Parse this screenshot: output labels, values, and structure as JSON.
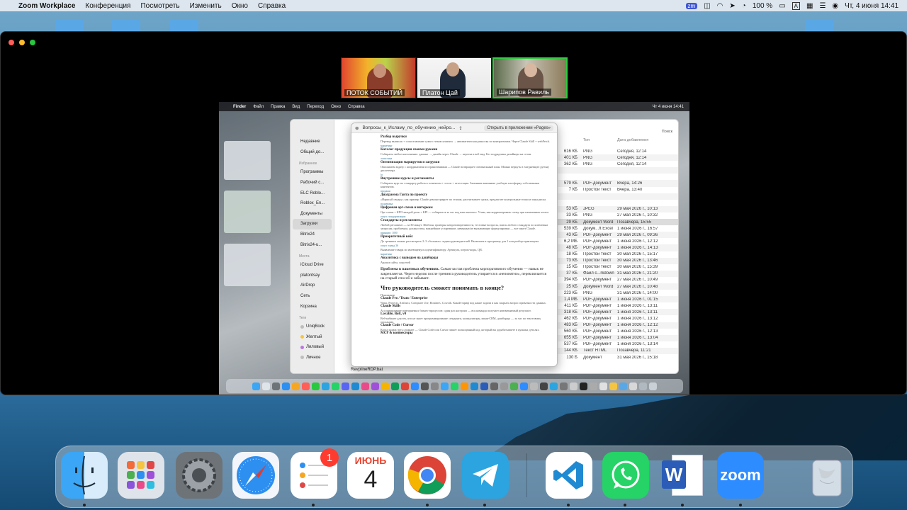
{
  "menubar": {
    "app_name": "Zoom Workplace",
    "menus": [
      "Конференция",
      "Посмотреть",
      "Изменить",
      "Окно",
      "Справка"
    ],
    "battery": "100 %",
    "input_badge": "A",
    "datetime": "Чт, 4 июня  14:41"
  },
  "participants": [
    {
      "name": "ПОТОК СОБЫТИЙ"
    },
    {
      "name": "Платон Цай"
    },
    {
      "name": "Шарипов Равиль"
    }
  ],
  "shared_screen": {
    "menubar": {
      "app": "Finder",
      "menus": [
        "Файл",
        "Правка",
        "Вид",
        "Переход",
        "Окно",
        "Справка"
      ],
      "datetime": "Чт 4 июня  14:41"
    },
    "finder": {
      "sidebar": {
        "recent": [
          "Недавние",
          "Общий до..."
        ],
        "favorites_title": "Избранное",
        "favorites": [
          "Программы",
          "Рабочий с...",
          "ELC Roblo...",
          "Roblox_En...",
          "Документы",
          "Загрузки",
          "Bitrix24",
          "Bitrix24-u..."
        ],
        "places_title": "Места",
        "places": [
          "iCloud Drive",
          "platontsay",
          "AirDrop",
          "Сеть",
          "Корзина"
        ],
        "tags_title": "Теги",
        "tags": [
          {
            "label": "UniqBook",
            "color": "#bdbdbd"
          },
          {
            "label": "Желтый",
            "color": "#f5c542"
          },
          {
            "label": "Лиловый",
            "color": "#b87ad9"
          },
          {
            "label": "Личное",
            "color": "#bdbdbd"
          }
        ]
      },
      "columns": {
        "type": "Тип",
        "date": "Дата добавления",
        "search": "Поиск"
      },
      "rows": [
        {
          "size": "616 КБ",
          "type": "PNG",
          "date": "Сегодня, 12:14"
        },
        {
          "size": "401 КБ",
          "type": "PNG",
          "date": "Сегодня, 12:14"
        },
        {
          "size": "362 КБ",
          "type": "PNG",
          "date": "Сегодня, 12:14"
        },
        {
          "size": "",
          "type": "",
          "date": ""
        },
        {
          "size": "",
          "type": "",
          "date": ""
        },
        {
          "size": "579 КБ",
          "type": "PDF-документ",
          "date": "Вчера, 14:26"
        },
        {
          "size": "7 КБ",
          "type": "Простой текст",
          "date": "Вчера, 13:40"
        },
        {
          "size": "",
          "type": "",
          "date": ""
        },
        {
          "size": "",
          "type": "",
          "date": ""
        },
        {
          "size": "53 КБ",
          "type": "JPEG",
          "date": "29 мая 2026 г., 10:13"
        },
        {
          "size": "33 КБ",
          "type": "PNG",
          "date": "27 мая 2026 г., 10:32"
        },
        {
          "size": "29 КБ",
          "type": "Документ Word",
          "date": "Позавчера, 15:55"
        },
        {
          "size": "539 КБ",
          "type": "Докум...ft Excel",
          "date": "1 июня 2026 г., 16:57"
        },
        {
          "size": "43 КБ",
          "type": "PDF-документ",
          "date": "29 мая 2026 г., 09:36"
        },
        {
          "size": "6,2 МБ",
          "type": "PDF-документ",
          "date": "1 июня 2026 г., 12:12"
        },
        {
          "size": "48 КБ",
          "type": "PDF-документ",
          "date": "1 июня 2026 г., 14:13"
        },
        {
          "size": "18 КБ",
          "type": "Простой текст",
          "date": "30 мая 2026 г., 15:17"
        },
        {
          "size": "73 КБ",
          "type": "Простой текст",
          "date": "30 мая 2026 г., 13:46"
        },
        {
          "size": "15 КБ",
          "type": "Простой текст",
          "date": "30 мая 2026 г., 15:39"
        },
        {
          "size": "37 КБ",
          "type": "Файл с...rkdown",
          "date": "31 мая 2026 г., 21:20"
        },
        {
          "size": "394 КБ",
          "type": "PDF-документ",
          "date": "27 мая 2026 г., 10:49"
        },
        {
          "size": "25 КБ",
          "type": "Документ Word",
          "date": "27 мая 2026 г., 10:48"
        },
        {
          "size": "223 КБ",
          "type": "PNG",
          "date": "31 мая 2026 г., 14:00"
        },
        {
          "size": "1,4 МБ",
          "type": "PDF-документ",
          "date": "1 июня 2026 г., 01:15"
        },
        {
          "size": "411 КБ",
          "type": "PDF-документ",
          "date": "1 июня 2026 г., 13:11"
        },
        {
          "size": "318 КБ",
          "type": "PDF-документ",
          "date": "1 июня 2026 г., 13:11"
        },
        {
          "size": "462 КБ",
          "type": "PDF-документ",
          "date": "1 июня 2026 г., 13:12"
        },
        {
          "size": "483 КБ",
          "type": "PDF-документ",
          "date": "1 июня 2026 г., 12:12"
        },
        {
          "size": "560 КБ",
          "type": "PDF-документ",
          "date": "1 июня 2026 г., 12:13"
        },
        {
          "size": "655 КБ",
          "type": "PDF-документ",
          "date": "1 июня 2026 г., 13:04"
        },
        {
          "size": "537 КБ",
          "type": "PDF-документ",
          "date": "1 июня 2026 г., 13:14"
        },
        {
          "size": "144 КБ",
          "type": "Текст HTML",
          "date": "Позавчера, 11:21"
        },
        {
          "size": "130 Б",
          "type": "Документ",
          "date": "31 мая 2026 г., 15:18"
        }
      ],
      "bottom_file": "RevplineRDP.bat"
    },
    "document": {
      "title": "Вопросы_к_Исламу_по_обучению_нейро...",
      "open_button": "Открыть в приложении «Pages»",
      "blocks": [
        {
          "kind": "h",
          "text": "Разбор выручки"
        },
        {
          "kind": "small",
          "text": "Перевод выписок + сопоставление сумм с чеком клиента → автоматическая разноска по контрагентам. Через Claude Skill + webFetch."
        },
        {
          "kind": "tag",
          "text": "маркетинг"
        },
        {
          "kind": "h",
          "text": "Каталог продукции своими руками"
        },
        {
          "kind": "small",
          "text": "Собираем любое наполнение: данные → дизайн через Claude → верстка в веб-вид. Без подрядчика дизайнера на сезон."
        },
        {
          "kind": "tag",
          "text": "логистика"
        },
        {
          "kind": "h",
          "text": "Оптимизация маршрутов и загрузки"
        },
        {
          "kind": "small",
          "text": "Описываем задачу с координатами и ограничениями — Claude возвращает оптимальный план. Можно вернуть в ежедневную рутину диспетчера."
        },
        {
          "kind": "tag",
          "text": "hr"
        },
        {
          "kind": "h",
          "text": "Внутренние курсы и регламенты"
        },
        {
          "kind": "small",
          "text": "Собираем курс по стандарту работы с клиентом + тесты + аттестация. Заменяем внешнюю учебную платформу собственным контентом."
        },
        {
          "kind": "tag",
          "text": "продажи"
        },
        {
          "kind": "h",
          "text": "Диаграмма Ганта по проекту"
        },
        {
          "kind": "small",
          "text": "«Нарисуй сводку» как пример: Claude демонстрирует по этапам, рассчитывает сроки, предлагает контрольные точки и зоны риска."
        },
        {
          "kind": "tag",
          "text": "поддержка"
        },
        {
          "kind": "h",
          "text": "Цифровая орг-схема и интерком"
        },
        {
          "kind": "small",
          "text": "Орг-схема + КПЭ каждой роли + KPI — собирается за час под ваш контекст. Учим, как корректировать схему при изменениях штата."
        },
        {
          "kind": "tag",
          "text": "отдел стандартизации"
        },
        {
          "kind": "h",
          "text": "Стандарты и регламенты"
        },
        {
          "kind": "small",
          "text": "Любой регламент — за 30 минут. Шаблон, проверка непротиворечивости, тестовые вопросы, поиск любого стандарта по ключевым запросам, проблемам, должностям, важнейшие устаревшие, неверные/не вызывающие формулировки — все через Claude."
        },
        {
          "kind": "tag",
          "text": "принцип: 1000"
        },
        {
          "kind": "h",
          "text": "Приоритетный кейс"
        },
        {
          "kind": "small",
          "text": "До тренинга можно рассмотреть 2–3 «больных» задачи руководителей. Включаем в программу для 1 или разбор-практикума."
        },
        {
          "kind": "tag",
          "text": "отдел: тренд 36"
        },
        {
          "kind": "small",
          "text": "Выявление товара по имеющемуся идентификатору. Артикула, штрих-коды, QR."
        },
        {
          "kind": "tag",
          "text": "маркетинг"
        },
        {
          "kind": "h",
          "text": "Аналитика с выводом на дашборды"
        },
        {
          "kind": "small",
          "text": "Анализ сайта, соцсетей"
        }
      ],
      "problem_bold": "Проблема в пакетных обучениях.",
      "problem_text": "Самая частая проблема корпоративного обучения — навык не закрепляется. Через неделю после тренинга руководитель упирается в «непонятно», переключается на старый способ и забывает.",
      "heading_big": "Что руководитель сможет понимать в конце?",
      "subhead": "Понимание",
      "blocks2": [
        {
          "kind": "h",
          "text": "Claude Pro / Team / Enterprise"
        },
        {
          "kind": "small",
          "text": "Чаты, Projects, Artifacts, Computer Use, Routines, Cowork. Какой тариф под какие задачи и как закрыть вопрос приватности данных."
        },
        {
          "kind": "h",
          "text": "Claude Skills"
        },
        {
          "kind": "small",
          "text": "Ассоциирование повторяемых бизнес-процессов: один раз настроил — вся команда получает неизменяемый результат."
        },
        {
          "kind": "h",
          "text": "Lovable, Bolt, v0"
        },
        {
          "kind": "small",
          "text": "Веб-кабинет для тех, кто не знает программирование: лендинги, калькуляторы, мини-CRM, дашборды — за час по текстовому описанию."
        },
        {
          "kind": "h",
          "text": "Claude Code / Cursor"
        },
        {
          "kind": "small",
          "text": "Когда задача чуть сложнее — Claude Code или Cursor пишет полноценный код, который вы дорабатываете в нужных деталях."
        },
        {
          "kind": "h",
          "text": "MCP & коннекторы"
        }
      ]
    }
  },
  "dock": {
    "apps": [
      {
        "id": "finder",
        "label": "Finder"
      },
      {
        "id": "launchpad",
        "label": "Launchpad"
      },
      {
        "id": "settings",
        "label": "System Settings"
      },
      {
        "id": "safari",
        "label": "Safari"
      },
      {
        "id": "reminders",
        "label": "Reminders"
      },
      {
        "id": "calendar",
        "label": "Calendar"
      },
      {
        "id": "chrome",
        "label": "Chrome"
      },
      {
        "id": "telegram",
        "label": "Telegram"
      },
      {
        "id": "vscode",
        "label": "VS Code"
      },
      {
        "id": "whatsapp",
        "label": "WhatsApp"
      },
      {
        "id": "word",
        "label": "Word"
      },
      {
        "id": "zoom",
        "label": "zoom"
      },
      {
        "id": "trash",
        "label": "Trash"
      }
    ],
    "reminders_badge": "1",
    "calendar_month": "ИЮНЬ",
    "calendar_day": "4",
    "word_letter": "W",
    "zoom_label": "zoom"
  }
}
